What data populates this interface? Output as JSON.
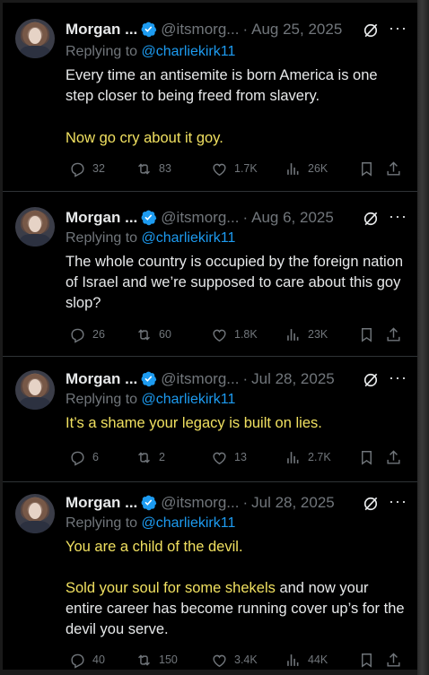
{
  "tweets": [
    {
      "name": "Morgan ...",
      "handle": "@itsmorg...",
      "dot": "·",
      "date": "Aug 25, 2025",
      "more": "···",
      "replying_prefix": "Replying to",
      "replying_to": "@charliekirk11",
      "text_main": "Every time an antisemite is born America is one step closer to being freed from slavery.",
      "text_yellow": "Now go cry about it goy.",
      "replies": "32",
      "reposts": "83",
      "likes": "1.7K",
      "views": "26K"
    },
    {
      "name": "Morgan ...",
      "handle": "@itsmorg...",
      "dot": "·",
      "date": "Aug 6, 2025",
      "more": "···",
      "replying_prefix": "Replying to",
      "replying_to": "@charliekirk11",
      "text_main": "The whole country is occupied by the foreign nation of Israel and we’re supposed to care about this goy slop?",
      "replies": "26",
      "reposts": "60",
      "likes": "1.8K",
      "views": "23K"
    },
    {
      "name": "Morgan ...",
      "handle": "@itsmorg...",
      "dot": "·",
      "date": "Jul 28, 2025",
      "more": "···",
      "replying_prefix": "Replying to",
      "replying_to": "@charliekirk11",
      "text_yellow": "It’s a shame your legacy is built on lies.",
      "replies": "6",
      "reposts": "2",
      "likes": "13",
      "views": "2.7K"
    },
    {
      "name": "Morgan ...",
      "handle": "@itsmorg...",
      "dot": "·",
      "date": "Jul 28, 2025",
      "more": "···",
      "replying_prefix": "Replying to",
      "replying_to": "@charliekirk11",
      "text_yellow": "You are a child of the devil.",
      "text_yellow_2": "Sold your soul for some shekels",
      "text_rest": " and now your entire career has become running cover up’s for the devil you serve.",
      "replies": "40",
      "reposts": "150",
      "likes": "3.4K",
      "views": "44K"
    }
  ],
  "icons": {
    "verified": "verified-badge-icon",
    "grok": "grok-icon",
    "reply": "reply-icon",
    "repost": "repost-icon",
    "like": "like-icon",
    "views": "views-icon",
    "bookmark": "bookmark-icon",
    "share": "share-icon"
  },
  "colors": {
    "background": "#000000",
    "text": "#e7e9ea",
    "muted": "#71767b",
    "link": "#1d9bf0",
    "highlight": "#f0e060"
  }
}
